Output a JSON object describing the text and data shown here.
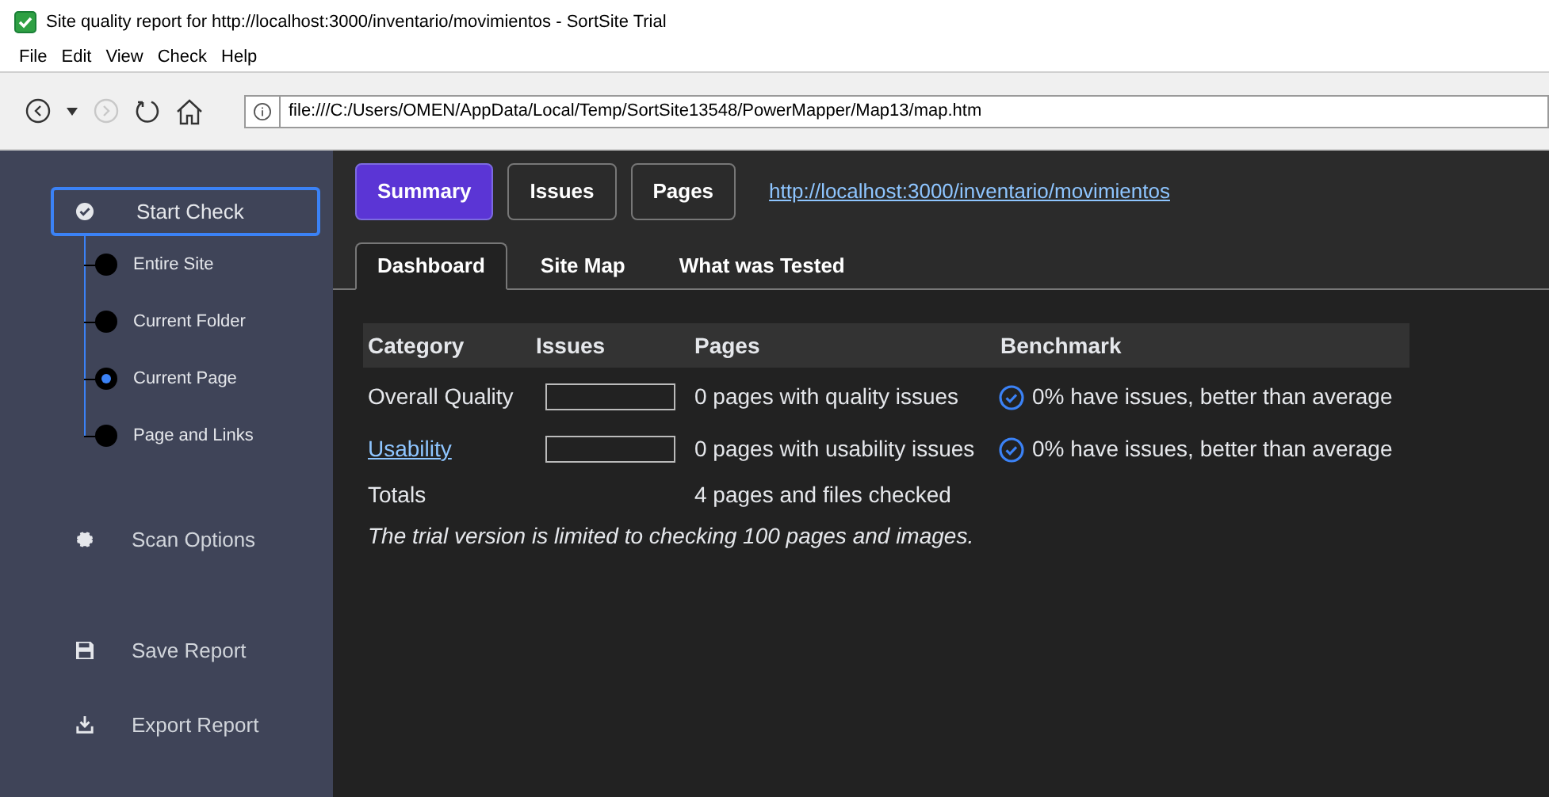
{
  "window": {
    "title": "Site quality report for http://localhost:3000/inventario/movimientos - SortSite Trial"
  },
  "menu": [
    "File",
    "Edit",
    "View",
    "Check",
    "Help"
  ],
  "address": {
    "value": "file:///C:/Users/OMEN/AppData/Local/Temp/SortSite13548/PowerMapper/Map13/map.htm"
  },
  "sidebar": {
    "start_check": "Start Check",
    "scopes": [
      {
        "label": "Entire Site",
        "selected": false
      },
      {
        "label": "Current Folder",
        "selected": false
      },
      {
        "label": "Current Page",
        "selected": true
      },
      {
        "label": "Page and Links",
        "selected": false
      }
    ],
    "actions": [
      {
        "kind": "options",
        "label": "Scan Options"
      },
      {
        "kind": "save",
        "label": "Save Report"
      },
      {
        "kind": "export",
        "label": "Export Report"
      }
    ]
  },
  "views": [
    {
      "label": "Summary",
      "selected": true
    },
    {
      "label": "Issues",
      "selected": false
    },
    {
      "label": "Pages",
      "selected": false
    }
  ],
  "site_link": "http://localhost:3000/inventario/movimientos",
  "tabs": [
    {
      "label": "Dashboard",
      "selected": true
    },
    {
      "label": "Site Map",
      "selected": false
    },
    {
      "label": "What was Tested",
      "selected": false
    }
  ],
  "table": {
    "columns": [
      "Category",
      "Issues",
      "Pages",
      "Benchmark"
    ],
    "rows": [
      {
        "category": "Overall Quality",
        "link": false,
        "level": 0,
        "pages": "0 pages with quality issues",
        "benchmark": "0% have issues, better than average"
      },
      {
        "category": "Usability",
        "link": true,
        "level": 0,
        "pages": "0 pages with usability issues",
        "benchmark": "0% have issues, better than average"
      }
    ],
    "totals": {
      "label": "Totals",
      "pages": "4 pages and files checked"
    }
  },
  "note": "The trial version is limited to checking 100 pages and images."
}
